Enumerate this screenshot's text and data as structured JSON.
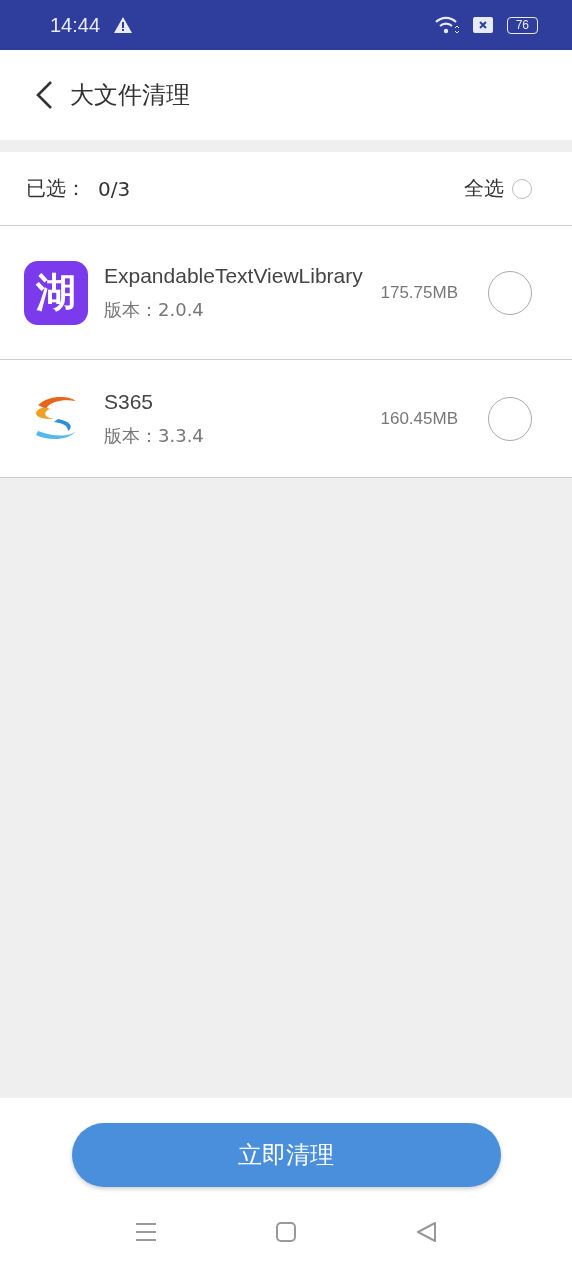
{
  "status_bar": {
    "time": "14:44",
    "battery": "76"
  },
  "header": {
    "title": "大文件清理"
  },
  "selection": {
    "label": "已选：",
    "count": "0/3",
    "select_all": "全选",
    "selected": false
  },
  "apps": [
    {
      "kind": "glyph",
      "icon_text": "湖",
      "name": "ExpandableTextViewLibrary",
      "version": "版本：2.0.4",
      "size": "175.75MB",
      "selected": false
    },
    {
      "kind": "ribbon",
      "name": "S365",
      "version": "版本：3.3.4",
      "size": "160.45MB",
      "selected": false
    }
  ],
  "action_button": "立即清理"
}
